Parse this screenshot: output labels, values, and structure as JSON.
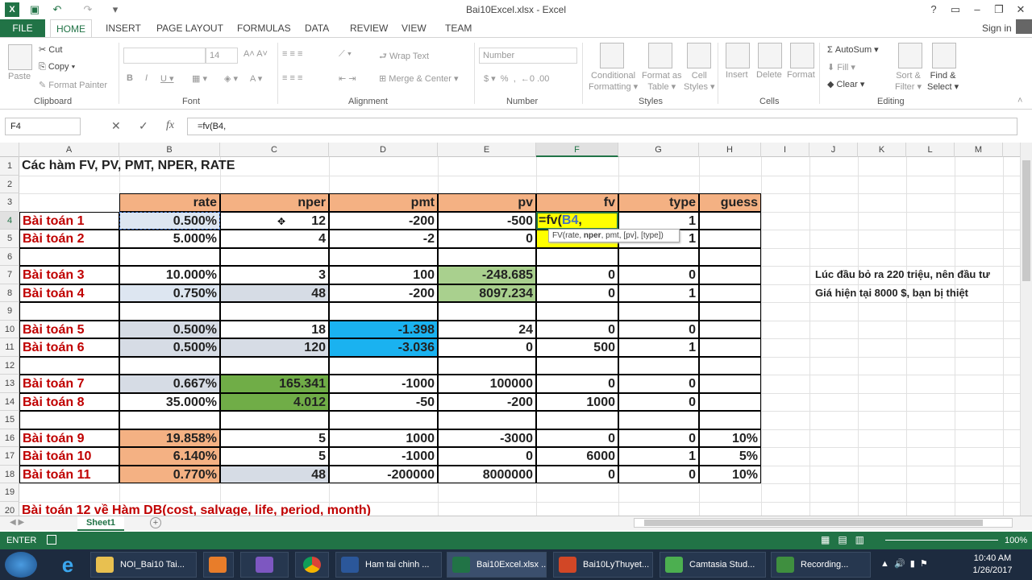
{
  "window": {
    "title": "Bai10Excel.xlsx - Excel",
    "help": "?",
    "signin": "Sign in"
  },
  "tabs": [
    "FILE",
    "HOME",
    "INSERT",
    "PAGE LAYOUT",
    "FORMULAS",
    "DATA",
    "REVIEW",
    "VIEW",
    "TEAM"
  ],
  "ribbon": {
    "paste": "Paste",
    "cut": "Cut",
    "copy": "Copy",
    "format_painter": "Format Painter",
    "font_size": "14",
    "wrap_text": "Wrap Text",
    "merge_center": "Merge & Center",
    "number_format": "Number",
    "cond_format": "Conditional",
    "cond_format2": "Formatting",
    "format_table": "Format as",
    "format_table2": "Table",
    "cell_styles": "Cell",
    "cell_styles2": "Styles",
    "insert": "Insert",
    "delete": "Delete",
    "format": "Format",
    "autosum": "AutoSum",
    "fill": "Fill",
    "clear": "Clear",
    "sort": "Sort &",
    "sort2": "Filter",
    "find": "Find &",
    "find2": "Select",
    "groups": {
      "clipboard": "Clipboard",
      "font": "Font",
      "alignment": "Alignment",
      "number": "Number",
      "styles": "Styles",
      "cells": "Cells",
      "editing": "Editing"
    }
  },
  "formula_bar": {
    "name_box": "F4",
    "formula": "=fv(B4,"
  },
  "columns": [
    "A",
    "B",
    "C",
    "D",
    "E",
    "F",
    "G",
    "H",
    "I",
    "J",
    "K",
    "L",
    "M"
  ],
  "rows": [
    "1",
    "2",
    "3",
    "4",
    "5",
    "6",
    "7",
    "8",
    "9",
    "10",
    "11",
    "12",
    "13",
    "14",
    "15",
    "16",
    "17",
    "18",
    "19",
    "20"
  ],
  "title": "Các  hàm FV, PV, PMT, NPER, RATE",
  "headers": {
    "rate": "rate",
    "nper": "nper",
    "pmt": "pmt",
    "pv": "pv",
    "fv": "fv",
    "type": "type",
    "guess": "guess"
  },
  "table": [
    {
      "row": 4,
      "label": "Bài toán 1",
      "rate": "0.500%",
      "nper": "12",
      "pmt": "-200",
      "pv": "-500",
      "fv": "=fv(B4,",
      "type": "1",
      "guess": ""
    },
    {
      "row": 5,
      "label": "Bài toán 2",
      "rate": "5.000%",
      "nper": "4",
      "pmt": "-2",
      "pv": "0",
      "fv": "",
      "type": "1",
      "guess": ""
    },
    {
      "row": 7,
      "label": "Bài toán 3",
      "rate": "10.000%",
      "nper": "3",
      "pmt": "100",
      "pv": "-248.685",
      "fv": "0",
      "type": "0",
      "guess": ""
    },
    {
      "row": 8,
      "label": "Bài toán 4",
      "rate": "0.750%",
      "nper": "48",
      "pmt": "-200",
      "pv": "8097.234",
      "fv": "0",
      "type": "1",
      "guess": ""
    },
    {
      "row": 10,
      "label": "Bài toán 5",
      "rate": "0.500%",
      "nper": "18",
      "pmt": "-1.398",
      "pv": "24",
      "fv": "0",
      "type": "0",
      "guess": ""
    },
    {
      "row": 11,
      "label": "Bài toán 6",
      "rate": "0.500%",
      "nper": "120",
      "pmt": "-3.036",
      "pv": "0",
      "fv": "500",
      "type": "1",
      "guess": ""
    },
    {
      "row": 13,
      "label": "Bài toán 7",
      "rate": "0.667%",
      "nper": "165.341",
      "pmt": "-1000",
      "pv": "100000",
      "fv": "0",
      "type": "0",
      "guess": ""
    },
    {
      "row": 14,
      "label": "Bài toán 8",
      "rate": "35.000%",
      "nper": "4.012",
      "pmt": "-50",
      "pv": "-200",
      "fv": "1000",
      "type": "0",
      "guess": ""
    },
    {
      "row": 16,
      "label": "Bài toán 9",
      "rate": "19.858%",
      "nper": "5",
      "pmt": "1000",
      "pv": "-3000",
      "fv": "0",
      "type": "0",
      "guess": "10%"
    },
    {
      "row": 17,
      "label": "Bài toán 10",
      "rate": "6.140%",
      "nper": "5",
      "pmt": "-1000",
      "pv": "0",
      "fv": "6000",
      "type": "1",
      "guess": "5%"
    },
    {
      "row": 18,
      "label": "Bài toán 11",
      "rate": "0.770%",
      "nper": "48",
      "pmt": "-200000",
      "pv": "8000000",
      "fv": "0",
      "type": "0",
      "guess": "10%"
    }
  ],
  "note1": "Lúc đầu bỏ ra 220 triệu, nên đầu tư",
  "note2": "Giá hiện tại 8000 $, bạn bị thiệt",
  "row20": "Bài toán 12 về Hàm DB(cost, salvage, life, period, month)",
  "tooltip": {
    "fn": "FV(rate, ",
    "bold": "nper",
    "rest": ", pmt, [pv], [type])"
  },
  "sheet_tab": "Sheet1",
  "status": {
    "mode": "ENTER",
    "zoom": "100%"
  },
  "colors": {
    "orange": "#f4b183",
    "green": "#70ad47",
    "lightgreen": "#a9d08e",
    "cyan": "#1ab2f0",
    "yellow": "#ffff00",
    "grey": "#d6dce5",
    "red": "#c00000",
    "excel": "#217346"
  },
  "taskbar": {
    "items": [
      "NOI_Bai10 Tai...",
      "",
      "",
      "",
      "Ham tai chinh ...",
      "Bai10Excel.xlsx ...",
      "Bai10LyThuyet...",
      "Camtasia Stud...",
      "Recording..."
    ],
    "time": "10:40 AM",
    "date": "1/26/2017"
  }
}
